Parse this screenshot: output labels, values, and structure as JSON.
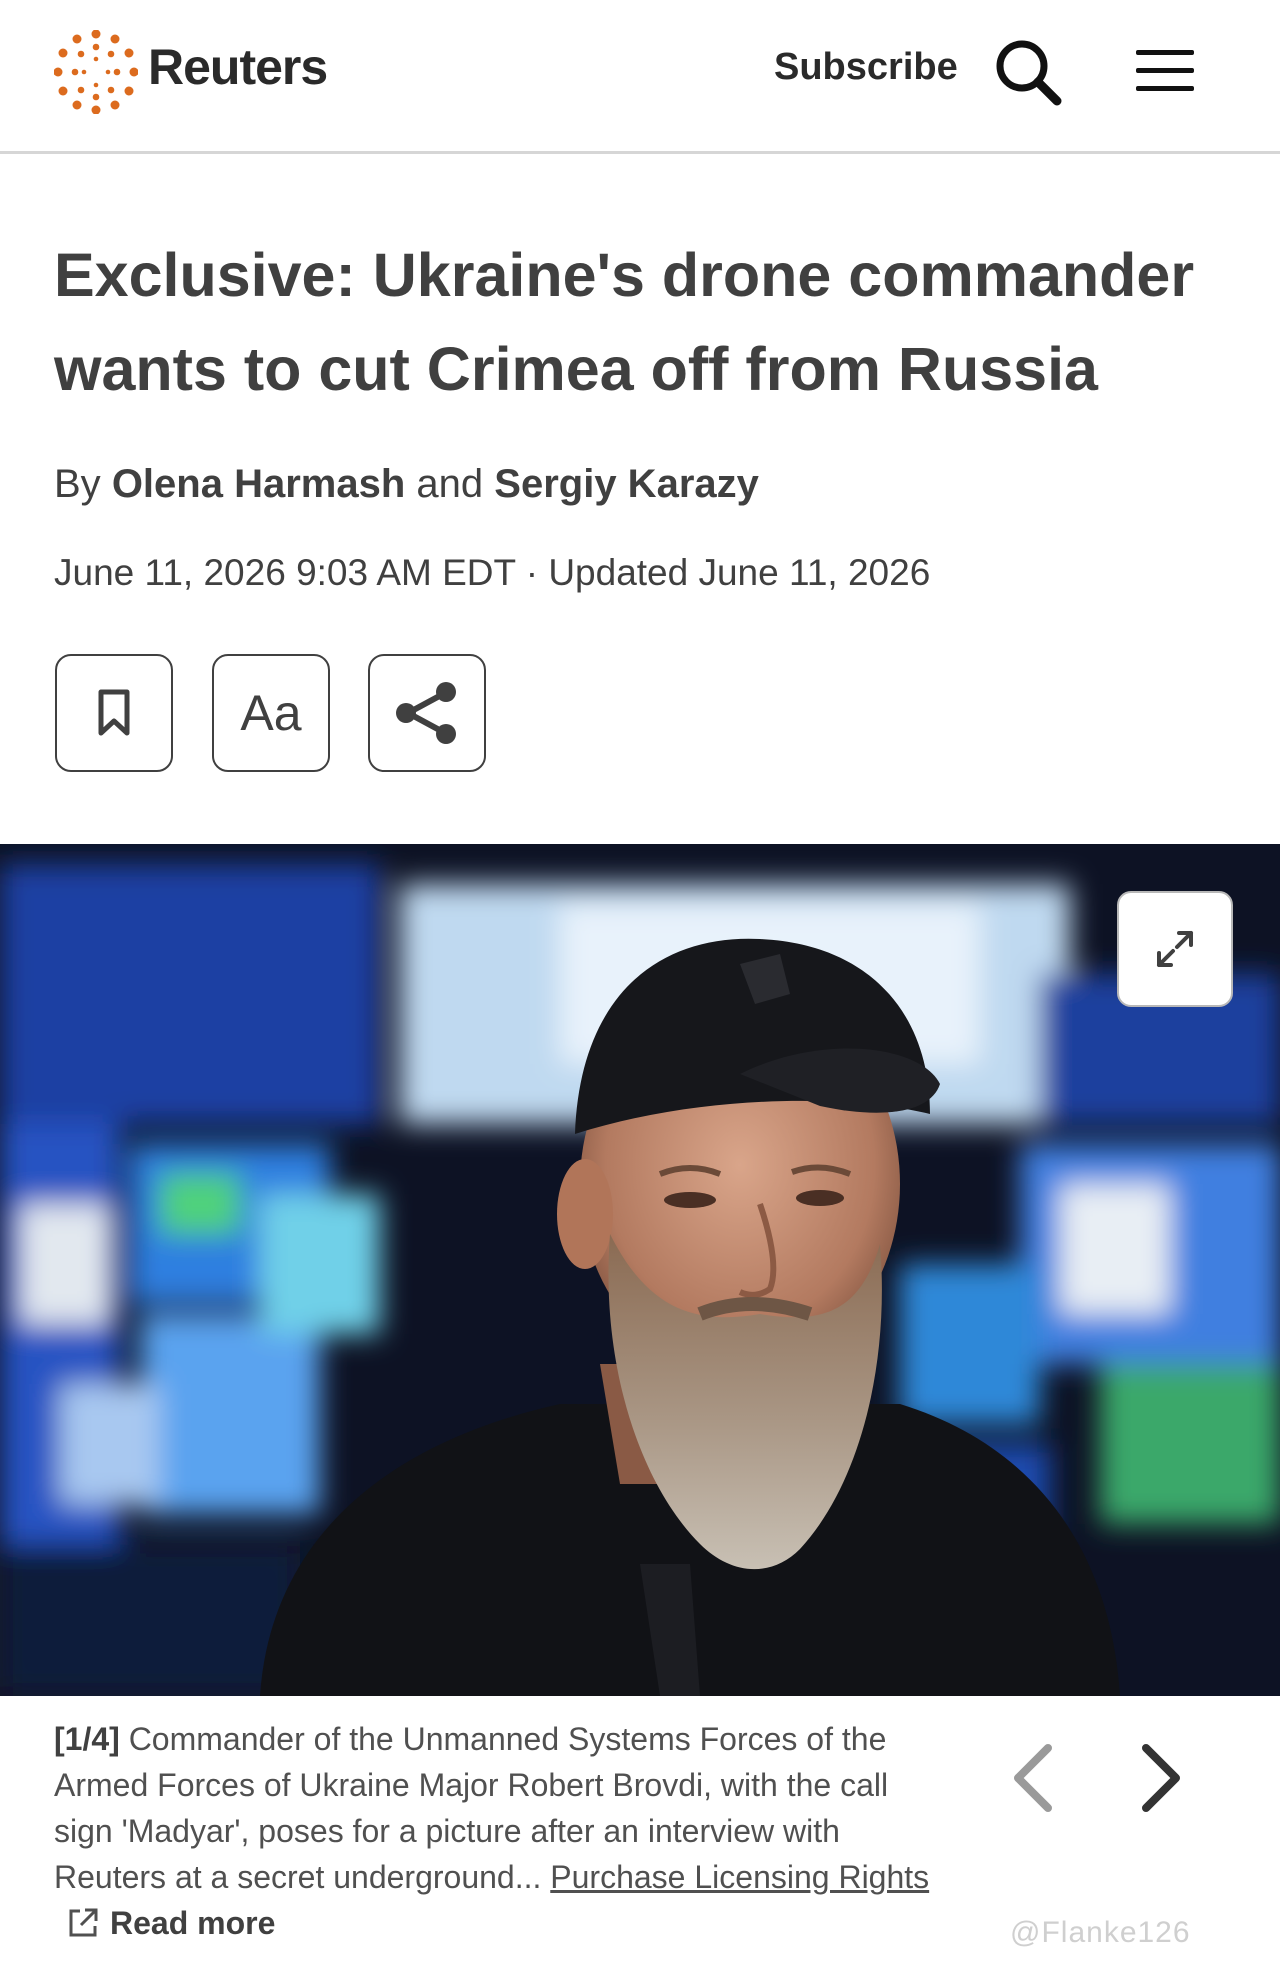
{
  "header": {
    "brand": "Reuters",
    "subscribe_label": "Subscribe",
    "icons": [
      "reuters-logo",
      "search-icon",
      "menu-icon"
    ]
  },
  "article": {
    "headline": "Exclusive: Ukraine's drone commander wants to cut Crimea off from Russia",
    "byline_prefix": "By",
    "author_1": "Olena Harmash",
    "byline_joiner": "and",
    "author_2": "Sergiy Karazy",
    "dateline": "June 11, 2026 9:03 AM EDT · Updated June 11, 2026"
  },
  "tools": {
    "font_label": "Aa",
    "icons": [
      "bookmark-icon",
      "font-size-icon",
      "share-icon"
    ]
  },
  "gallery": {
    "counter": "[1/4]",
    "caption": "Commander of the Unmanned Systems Forces of the Armed Forces of Ukraine Major Robert Brovdi, with the call sign 'Madyar', poses for a picture after an interview with Reuters at a secret underground...",
    "licensing_label": "Purchase Licensing Rights",
    "read_more_label": "Read more",
    "icons": [
      "expand-icon",
      "external-link-icon",
      "chevron-left-icon",
      "chevron-right-icon"
    ]
  },
  "watermark": "@Flanke126",
  "colors": {
    "text": "#404040",
    "logo_orange": "#dc6b1e",
    "divider": "#d6d6d6",
    "nav_disabled": "#9a9a9a"
  }
}
